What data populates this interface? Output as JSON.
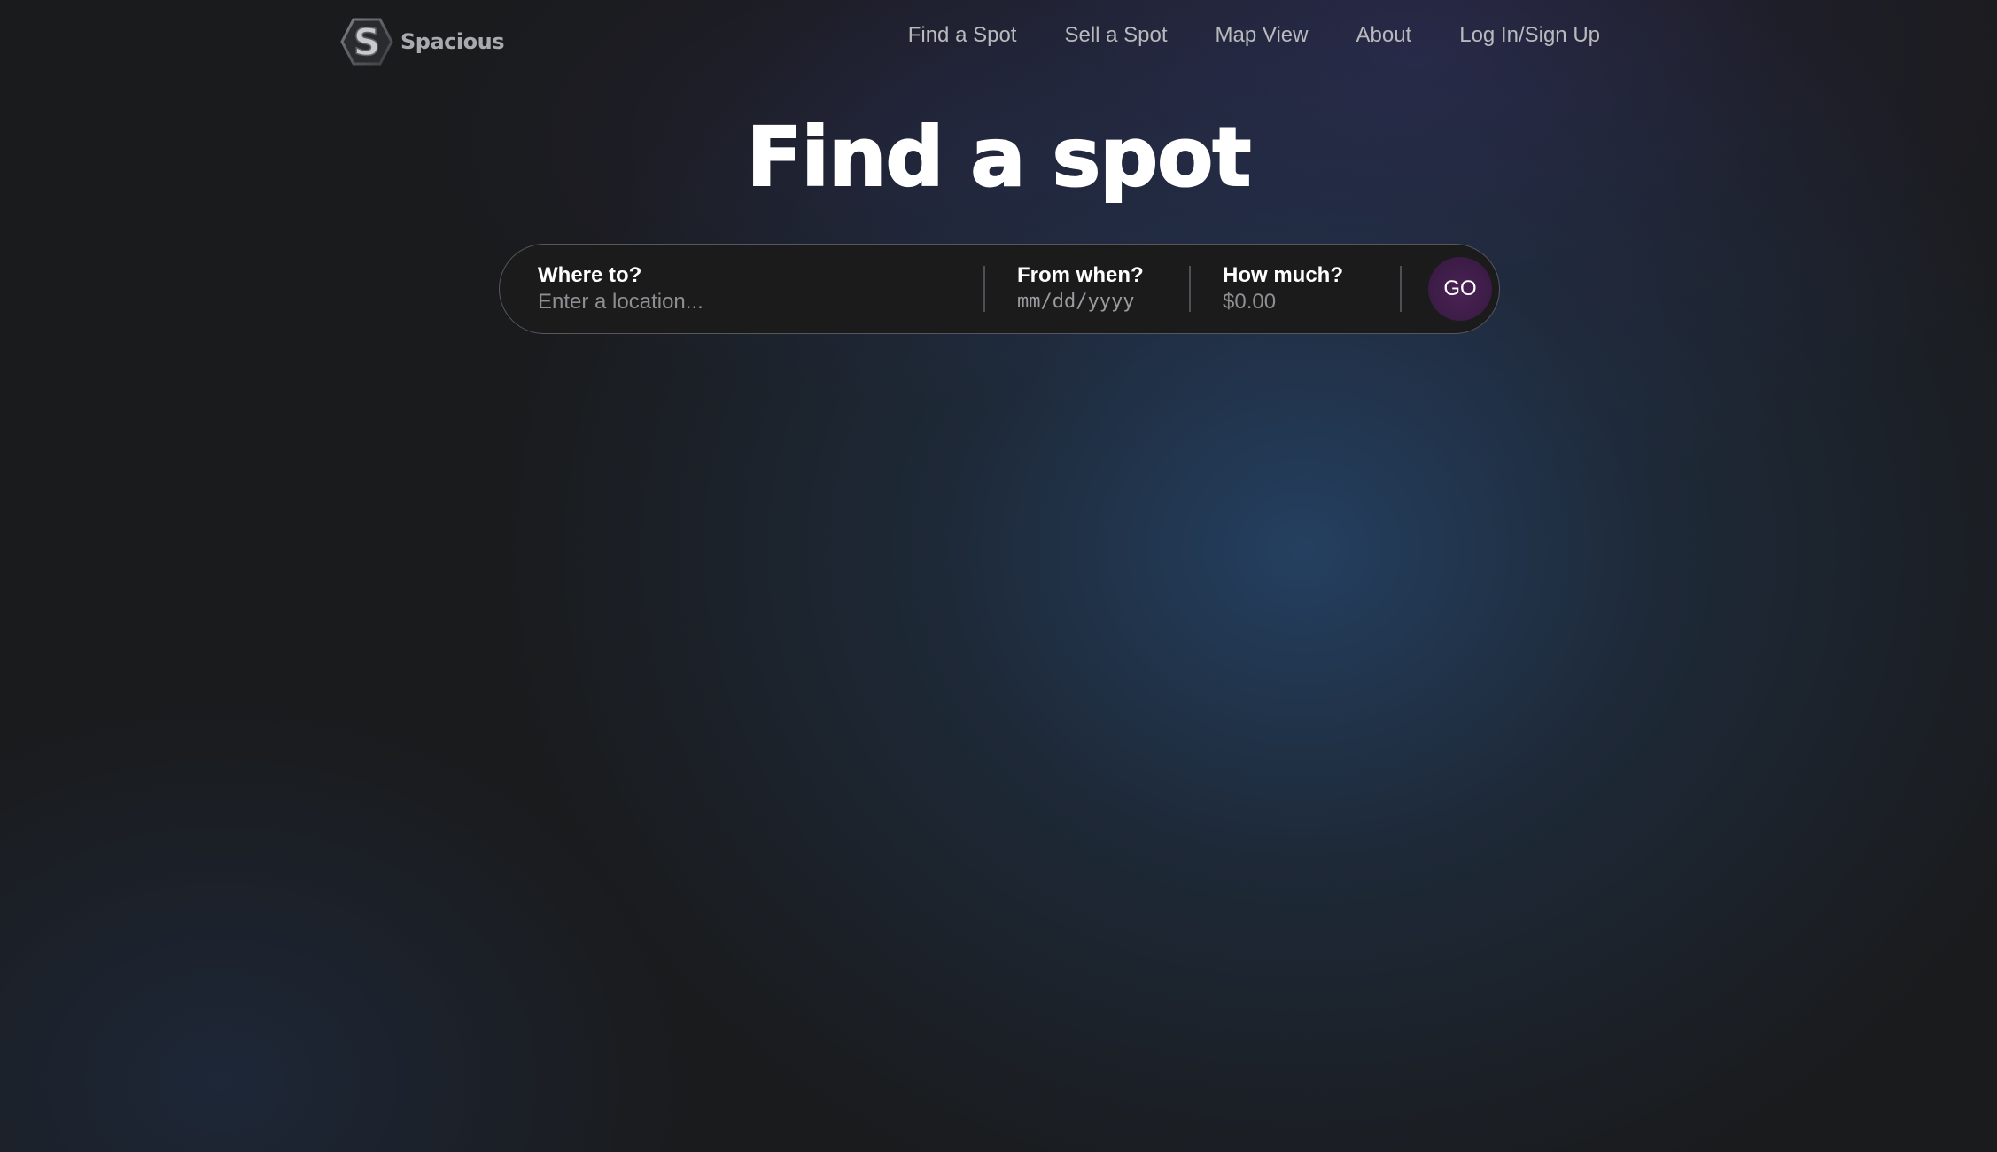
{
  "brand": {
    "name": "Spacious",
    "logo_letter": "S"
  },
  "nav": {
    "items": [
      {
        "label": "Find a Spot"
      },
      {
        "label": "Sell a Spot"
      },
      {
        "label": "Map View"
      },
      {
        "label": "About"
      },
      {
        "label": "Log In/Sign Up"
      }
    ]
  },
  "hero": {
    "title": "Find a spot"
  },
  "search": {
    "where": {
      "label": "Where to?",
      "placeholder": "Enter a location..."
    },
    "when": {
      "label": "From when?",
      "placeholder": "mm/dd/yyyy"
    },
    "much": {
      "label": "How much?",
      "placeholder": "$0.00"
    },
    "go_label": "GO"
  },
  "colors": {
    "background": "#1a1b1d",
    "glow_blue": "#26466c",
    "go_button": "#3b1c46",
    "nav_text": "#b9babd"
  }
}
